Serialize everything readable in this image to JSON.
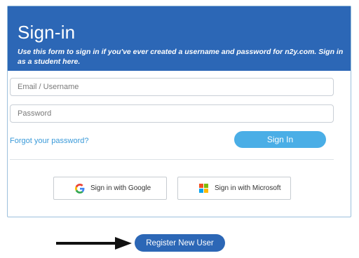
{
  "header": {
    "title": "Sign-in",
    "subtitle": "Use this form to sign in if you've ever created a username and password for n2y.com. Sign in as a student here."
  },
  "form": {
    "email_placeholder": "Email / Username",
    "password_placeholder": "Password",
    "forgot_label": "Forgot your password?",
    "signin_label": "Sign In"
  },
  "social": {
    "google_label": "Sign in with Google",
    "microsoft_label": "Sign in with Microsoft",
    "google_icon": "google-g-icon",
    "microsoft_icon": "microsoft-logo-icon"
  },
  "register": {
    "label": "Register New User",
    "arrow_icon": "arrow-right-icon"
  },
  "colors": {
    "header_bg": "#2c67b6",
    "signin_btn": "#4aaee6",
    "link": "#3a9ad9",
    "register_btn": "#2c67b6",
    "microsoft": [
      "#f25022",
      "#7fba00",
      "#00a4ef",
      "#ffb900"
    ]
  }
}
